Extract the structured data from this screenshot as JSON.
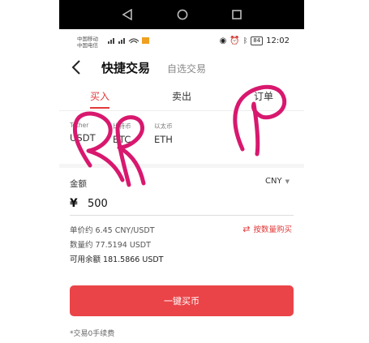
{
  "statusbar": {
    "carrier1": "中国移动",
    "carrier2": "中国电信",
    "battery": "84",
    "time": "12:02"
  },
  "header": {
    "title": "快捷交易",
    "subtitle": "自选交易"
  },
  "tabs": [
    "买入",
    "卖出",
    "订单"
  ],
  "coins": [
    {
      "sub": "Tether",
      "main": "USDT"
    },
    {
      "sub": "比特币",
      "main": "BTC"
    },
    {
      "sub": "以太币",
      "main": "ETH"
    }
  ],
  "form": {
    "amount_label": "金额",
    "currency": "CNY",
    "currency_symbol": "¥",
    "amount": "500",
    "unit_price": "单价约 6.45 CNY/USDT",
    "quantity": "数量约 77.5194 USDT",
    "balance": "可用余额 181.5866 USDT",
    "switch_mode": "按数量购买"
  },
  "buy_button": "一键买币",
  "fee_note": "*交易0手续费",
  "colors": {
    "accent": "#e23a3a",
    "button": "#ea4448",
    "scribble": "#d8186e"
  }
}
